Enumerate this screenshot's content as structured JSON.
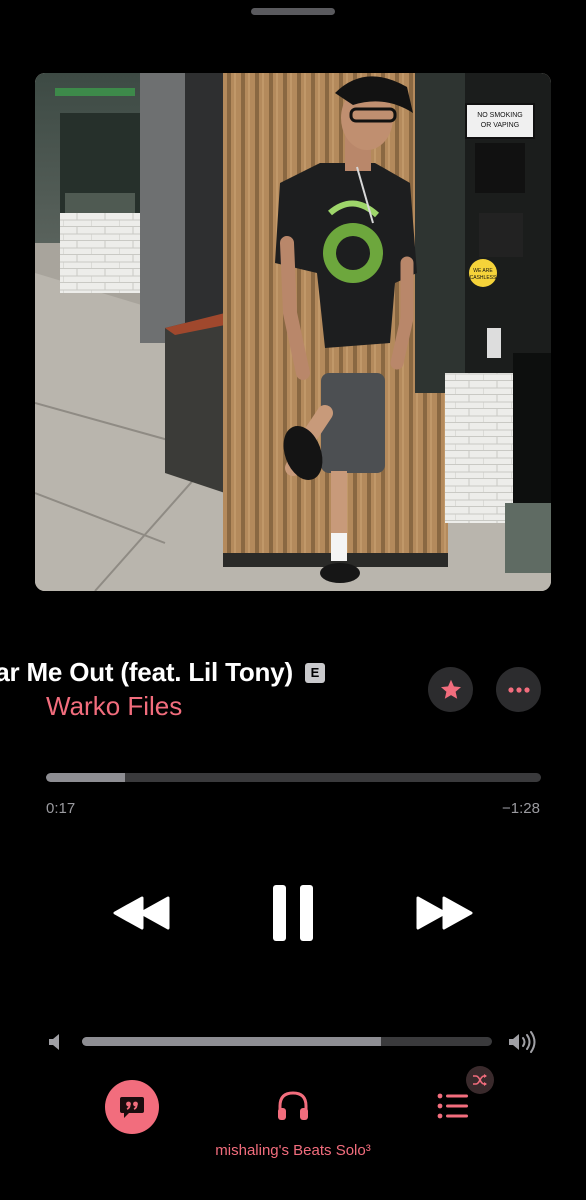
{
  "now_playing": {
    "title": "ear Me Out (feat. Lil Tony)",
    "explicit_badge": "E",
    "artist": "Warko Files",
    "elapsed": "0:17",
    "remaining": "−1:28",
    "progress_fraction": 0.16
  },
  "volume": {
    "level_fraction": 0.73
  },
  "output_device": "mishaling's Beats Solo³",
  "artwork": {
    "signs": [
      "NO SMOKING",
      "OR VAPING",
      "WE ARE",
      "CASHLESS"
    ]
  },
  "icons": {
    "favorite": "star-icon",
    "more": "ellipsis-icon",
    "rewind": "rewind-icon",
    "pause": "pause-icon",
    "forward": "fast-forward-icon",
    "volume_low": "speaker-low-icon",
    "volume_high": "speaker-high-icon",
    "lyrics": "lyrics-quote-icon",
    "airplay": "headphones-icon",
    "queue": "list-icon",
    "shuffle": "shuffle-icon"
  },
  "colors": {
    "accent": "#f26d7d",
    "background": "#000000",
    "track": "#3a3a3c",
    "fill": "#8e8e93"
  }
}
